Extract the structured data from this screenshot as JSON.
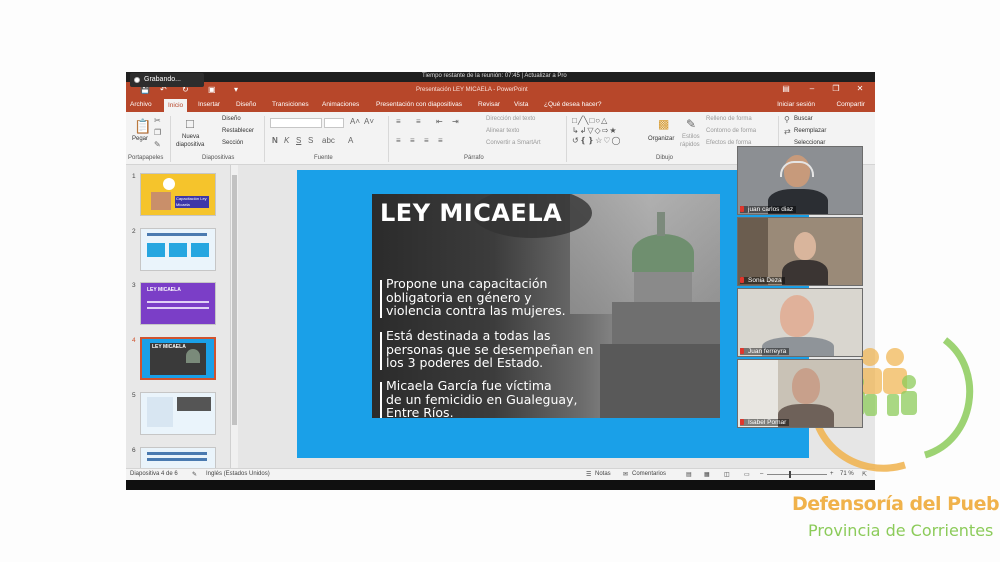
{
  "zoom": {
    "recording_label": "Grabando...",
    "meeting_time": "Tiempo restante de la reunión: 07:45 | Actualizar a Pro"
  },
  "window": {
    "title": "Presentación LEY MICAELA - PowerPoint",
    "login": "Iniciar sesión",
    "share": "Compartir"
  },
  "tabs": [
    {
      "label": "Archivo"
    },
    {
      "label": "Inicio"
    },
    {
      "label": "Insertar"
    },
    {
      "label": "Diseño"
    },
    {
      "label": "Transiciones"
    },
    {
      "label": "Animaciones"
    },
    {
      "label": "Presentación con diapositivas"
    },
    {
      "label": "Revisar"
    },
    {
      "label": "Vista"
    },
    {
      "label": "¿Qué desea hacer?"
    }
  ],
  "ribbon": {
    "paste": "Pegar",
    "new_slide": "Nueva",
    "new_slide2": "diapositiva",
    "layout": "Diseño",
    "reset": "Restablecer",
    "section": "Sección",
    "text_direction": "Dirección del texto",
    "align_text": "Alinear texto",
    "convert_smartart": "Convertir a SmartArt",
    "arrange": "Organizar",
    "quick_styles": "Estilos",
    "quick_styles2": "rápidos",
    "shape_fill": "Relleno de forma",
    "shape_outline": "Contorno de forma",
    "shape_effects": "Efectos de forma",
    "find": "Buscar",
    "replace": "Reemplazar",
    "select": "Seleccionar",
    "groups": {
      "clipboard": "Portapapeles",
      "slides": "Diapositivas",
      "font": "Fuente",
      "paragraph": "Párrafo",
      "drawing": "Dibujo"
    }
  },
  "thumbs": [
    "1",
    "2",
    "3",
    "4",
    "5",
    "6"
  ],
  "thumb_texts": {
    "t1": "Capacitación Ley Micaela",
    "t3": "LEY MICAELA",
    "t4": "LEY MICAELA"
  },
  "slide": {
    "title": "LEY MICAELA",
    "bullets": [
      "Propone una capacitación\nobligatoria en género y\nviolencia contra las mujeres.",
      "Está destinada a todas las\npersonas que se desempeñan en\nlos 3 poderes del Estado.",
      "Micaela García fue víctima\nde un femicidio en Gualeguay,\nEntre Ríos."
    ]
  },
  "status": {
    "slide_of": "Diapositiva 4 de 6",
    "language": "Inglés (Estados Unidos)",
    "notes": "Notas",
    "comments": "Comentarios",
    "zoom": "71 %"
  },
  "participants": [
    {
      "name": "juan carlos diaz"
    },
    {
      "name": "Sonia Deza"
    },
    {
      "name": "Juan ferreyra"
    },
    {
      "name": "Isabel Pomar"
    }
  ],
  "logo": {
    "line1": "Defensoría del Pueblo",
    "line2": "Provincia de Corrientes"
  },
  "colors": {
    "powerpoint_red": "#b7472a",
    "slide_blue": "#1aa0e8",
    "logo_orange": "#f0b24b",
    "logo_green": "#8ccb5a"
  }
}
